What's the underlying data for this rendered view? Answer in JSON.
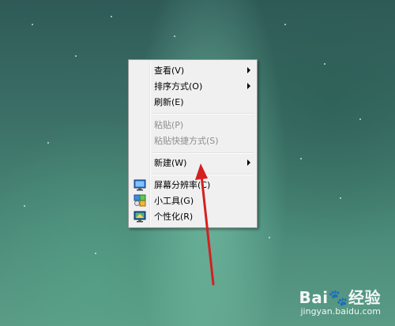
{
  "desktop": {
    "context_menu": {
      "items": [
        {
          "label": "查看(V)",
          "submenu": true,
          "enabled": true
        },
        {
          "label": "排序方式(O)",
          "submenu": true,
          "enabled": true
        },
        {
          "label": "刷新(E)",
          "submenu": false,
          "enabled": true
        },
        {
          "label": "粘贴(P)",
          "submenu": false,
          "enabled": false
        },
        {
          "label": "粘贴快捷方式(S)",
          "submenu": false,
          "enabled": false
        },
        {
          "label": "新建(W)",
          "submenu": true,
          "enabled": true
        },
        {
          "label": "屏幕分辨率(C)",
          "submenu": false,
          "enabled": true,
          "icon": "screen-resolution-icon"
        },
        {
          "label": "小工具(G)",
          "submenu": false,
          "enabled": true,
          "icon": "gadgets-icon"
        },
        {
          "label": "个性化(R)",
          "submenu": false,
          "enabled": true,
          "icon": "personalize-icon"
        }
      ]
    }
  },
  "watermark": {
    "brand": "Bai",
    "brand_suffix": "经验",
    "url": "jingyan.baidu.com"
  },
  "annotation": {
    "color": "#d42020"
  }
}
